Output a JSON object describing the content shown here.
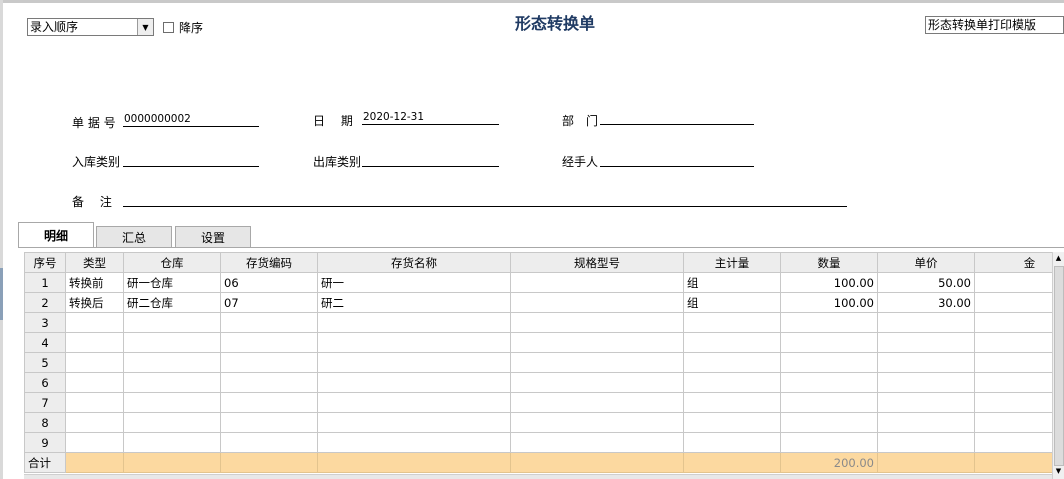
{
  "toolbar": {
    "sort_value": "录入顺序",
    "descending_label": "降序",
    "print_template": "形态转换单打印模版"
  },
  "title": "形态转换单",
  "header_fields": {
    "doc_no_label": "单 据 号",
    "doc_no_value": "0000000002",
    "date_label": "日　 期",
    "date_value": "2020-12-31",
    "dept_label": "部　门",
    "dept_value": "",
    "in_type_label": "入库类别",
    "in_type_value": "",
    "out_type_label": "出库类别",
    "out_type_value": "",
    "handler_label": "经手人",
    "handler_value": "",
    "remark_label": "备　 注",
    "remark_value": ""
  },
  "tabs": [
    "明细",
    "汇总",
    "设置"
  ],
  "grid": {
    "columns": [
      "序号",
      "类型",
      "仓库",
      "存货编码",
      "存货名称",
      "规格型号",
      "主计量",
      "数量",
      "单价",
      "金"
    ],
    "rows": [
      [
        "1",
        "转换前",
        "研一仓库",
        "06",
        "研一",
        "",
        "组",
        "100.00",
        "50.00",
        ""
      ],
      [
        "2",
        "转换后",
        "研二仓库",
        "07",
        "研二",
        "",
        "组",
        "100.00",
        "30.00",
        ""
      ],
      [
        "3",
        "",
        "",
        "",
        "",
        "",
        "",
        "",
        "",
        ""
      ],
      [
        "4",
        "",
        "",
        "",
        "",
        "",
        "",
        "",
        "",
        ""
      ],
      [
        "5",
        "",
        "",
        "",
        "",
        "",
        "",
        "",
        "",
        ""
      ],
      [
        "6",
        "",
        "",
        "",
        "",
        "",
        "",
        "",
        "",
        ""
      ],
      [
        "7",
        "",
        "",
        "",
        "",
        "",
        "",
        "",
        "",
        ""
      ],
      [
        "8",
        "",
        "",
        "",
        "",
        "",
        "",
        "",
        "",
        ""
      ],
      [
        "9",
        "",
        "",
        "",
        "",
        "",
        "",
        "",
        "",
        ""
      ]
    ],
    "total_row": [
      "合计",
      "",
      "",
      "",
      "",
      "",
      "",
      "200.00",
      "",
      ""
    ]
  }
}
